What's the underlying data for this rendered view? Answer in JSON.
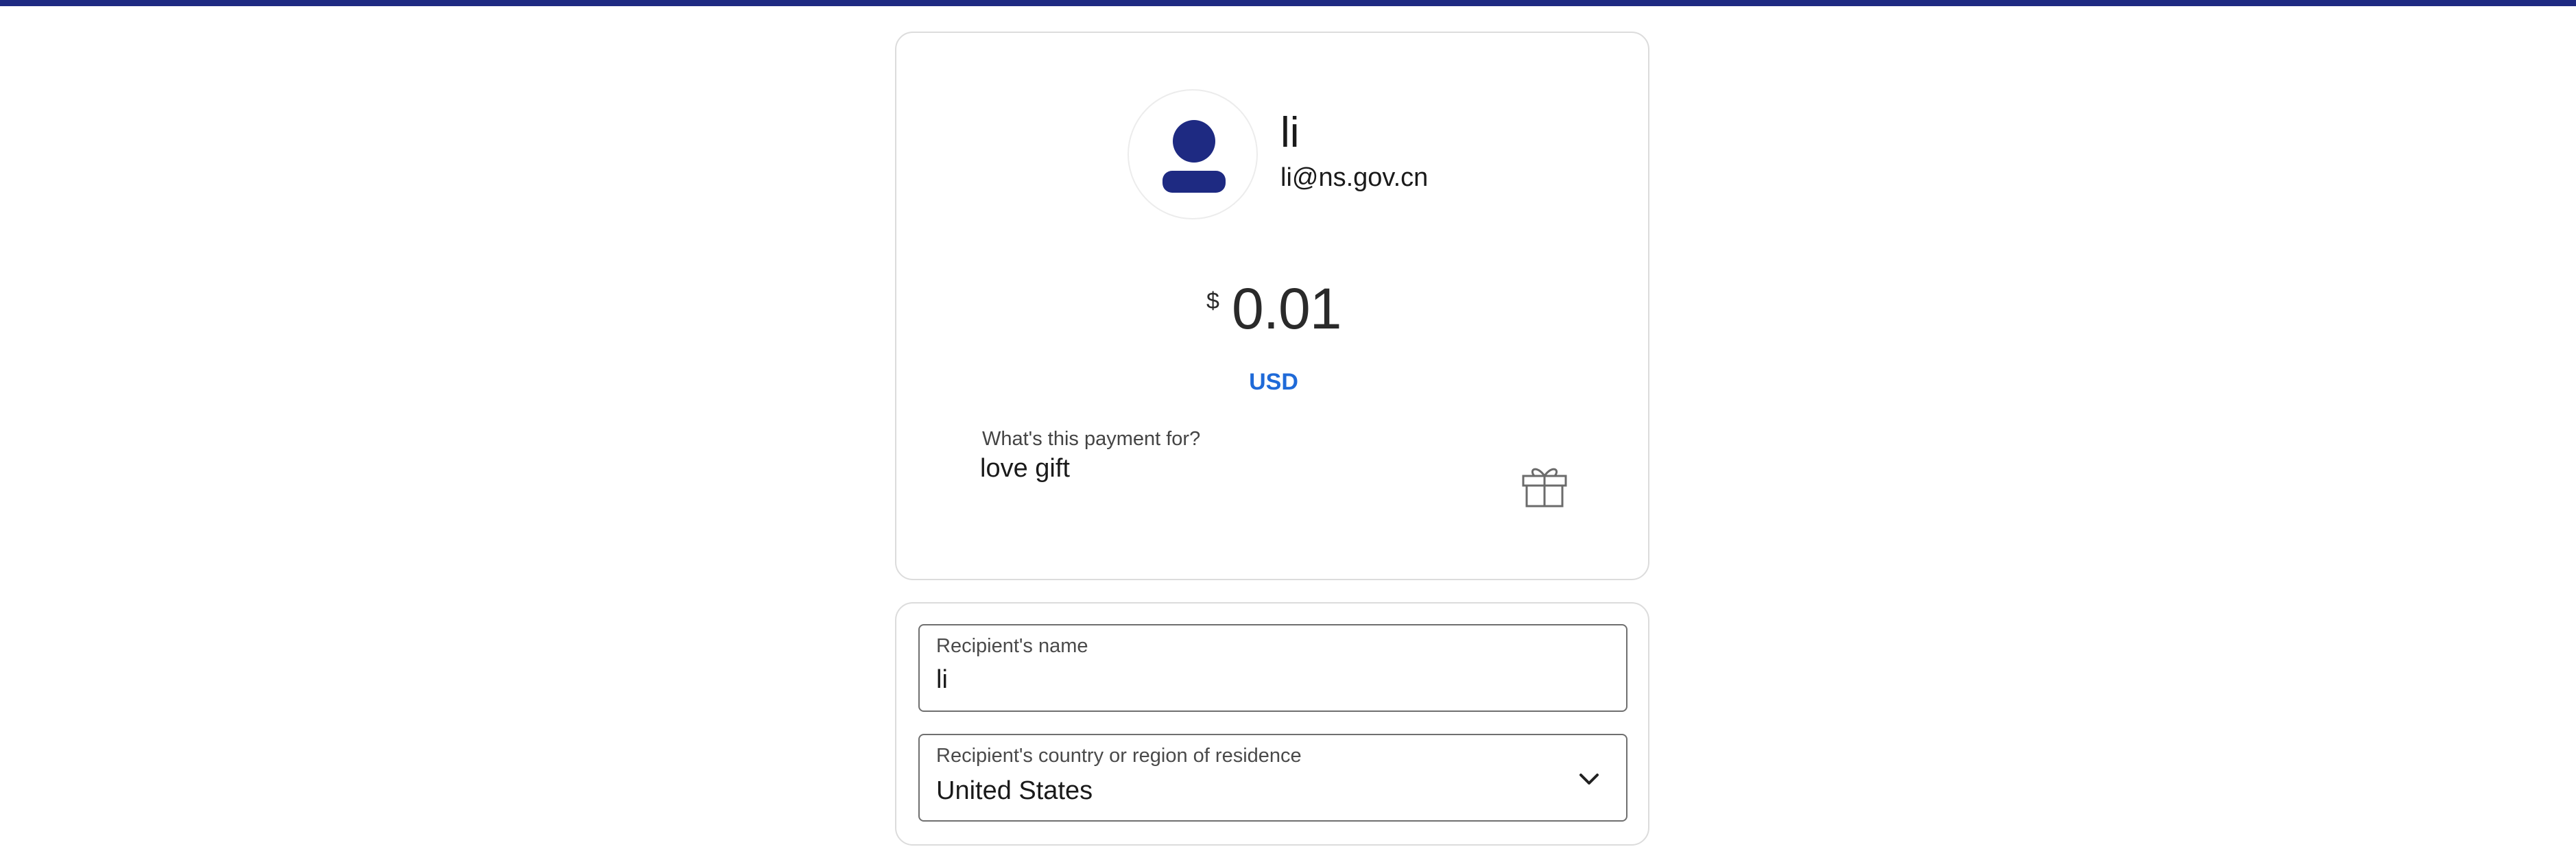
{
  "payee": {
    "name": "li",
    "email": "li@ns.gov.cn"
  },
  "amount": {
    "currency_symbol": "$",
    "value": "0.01",
    "currency_code": "USD"
  },
  "note": {
    "label": "What's this payment for?",
    "value": "love gift"
  },
  "recipient": {
    "name_label": "Recipient's name",
    "name_value": "li",
    "country_label": "Recipient's country or region of residence",
    "country_value": "United States"
  },
  "colors": {
    "brand": "#1e2a82",
    "link": "#1f6ad8",
    "border": "#dcdcdc",
    "field_border": "#6f6f6f"
  },
  "icons": {
    "avatar": "user-icon",
    "gift": "gift-icon",
    "dropdown": "chevron-down-icon"
  }
}
